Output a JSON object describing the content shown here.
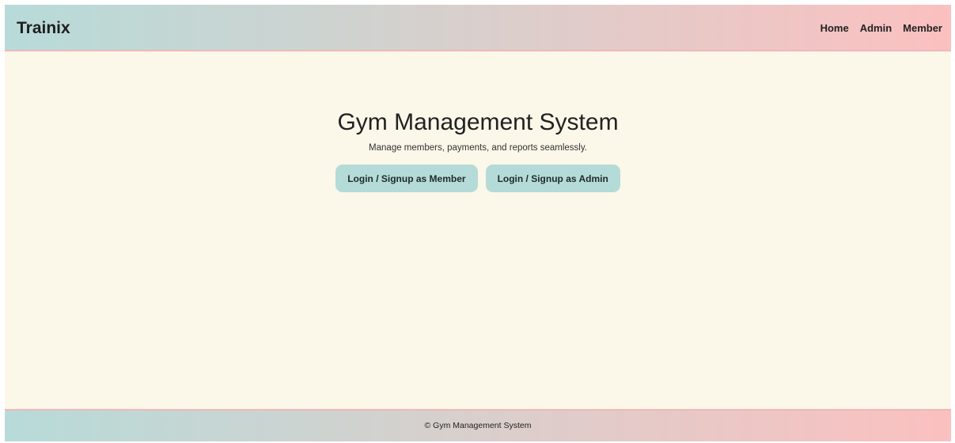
{
  "navbar": {
    "brand": "Trainix",
    "links": [
      {
        "label": "Home"
      },
      {
        "label": "Admin"
      },
      {
        "label": "Member"
      }
    ]
  },
  "hero": {
    "title": "Gym Management System",
    "subtitle": "Manage members, payments, and reports seamlessly.",
    "buttons": [
      {
        "label": "Login / Signup as Member"
      },
      {
        "label": "Login / Signup as Admin"
      }
    ]
  },
  "footer": {
    "text": "© Gym Management System"
  },
  "colors": {
    "background": "#fbf7e9",
    "gradient_start": "#b7dbd9",
    "gradient_end": "#fbc0c0",
    "button": "#b4dbd8"
  }
}
